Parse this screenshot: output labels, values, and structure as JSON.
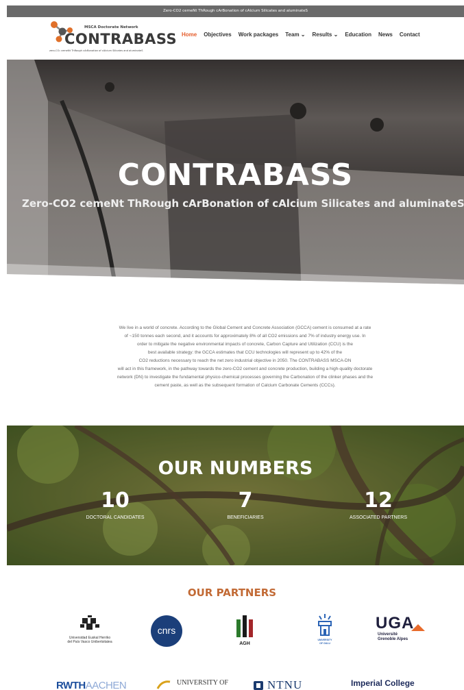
{
  "topbar": {
    "text": "Zero-CO2 cemeNt ThRough cArBonation of cAlcium Silicates and aluminateS"
  },
  "logo": {
    "network": "MSCA Doctorate Network",
    "name": "CONTRABASS",
    "tagline": "zero-CO₂ cemeNt ThRough cArBonation of cAlcium Silicates and aluminateS"
  },
  "nav": {
    "items": [
      {
        "label": "Home",
        "active": true
      },
      {
        "label": "Objectives"
      },
      {
        "label": "Work packages"
      },
      {
        "label": "Team ⌄"
      },
      {
        "label": "Results ⌄"
      },
      {
        "label": "Education"
      },
      {
        "label": "News"
      },
      {
        "label": "Contact"
      }
    ]
  },
  "hero": {
    "title": "CONTRABASS",
    "subtitle": "Zero-CO2 cemeNt ThRough cArBonation of cAlcium Silicates and aluminateS"
  },
  "intro": {
    "lines": [
      "We live in a world of concrete. According to the Global Cement and Concrete Association (GCCA) cement is consumed at a rate",
      "of ~150 tonnes each second, and it accounts for approximately 8% of all CO2 emissions and 7% of industry energy use. In",
      "order to mitigate the negative environmental impacts of concrete, Carbon Capture and Utilization (CCU) is the",
      "best available strategy: the GCCA estimates that CCU technologies will represent up to 42% of the",
      "CO2 reductions necessary to reach the net zero industrial objective in 2050. The CONTRABASS MSCA-DN",
      "will act in this framework, in the pathway towards the zero-CO2 cement and concrete production, building a high-quality doctorate",
      "network (DN) to investigate the fundamental physico-chemical processes governing the Carbonation of the clinker phases and the",
      "cement paste, as well as the subsequent formation of Calcium Carbonate Cements (CCCs)."
    ]
  },
  "numbers": {
    "title": "OUR NUMBERS",
    "stats": [
      {
        "value": "10",
        "label": "DOCTORAL CANDIDATES"
      },
      {
        "value": "7",
        "label": "BENEFICIARIES"
      },
      {
        "value": "12",
        "label": "ASSOCIATED PARTNERS"
      }
    ]
  },
  "partners": {
    "title": "OUR PARTNERS",
    "row1": [
      {
        "name": "ehu-logo",
        "line1": "Universidad   Euskal Herriko",
        "line2": "del País Vasco   Unibertsitatea"
      },
      {
        "name": "cnrs-logo",
        "text": "cnrs"
      },
      {
        "name": "agh-logo",
        "text": "AGH"
      },
      {
        "name": "oulu-logo",
        "line1": "UNIVERSITY",
        "line2": "OF OULU"
      },
      {
        "name": "uga-logo",
        "text": "UGA",
        "line1": "Université",
        "line2": "Grenoble Alpes"
      }
    ],
    "row2": [
      {
        "name": "rwth-logo",
        "text": "RWTH",
        "text2": "AACHEN"
      },
      {
        "name": "oviedo-logo",
        "text": "UNIVERSITY OF"
      },
      {
        "name": "ntnu-logo",
        "text": "NTNU"
      },
      {
        "name": "imperial-logo",
        "text": "Imperial College"
      }
    ]
  },
  "colors": {
    "accent": "#e55d2c",
    "partners_title": "#c26a35"
  }
}
